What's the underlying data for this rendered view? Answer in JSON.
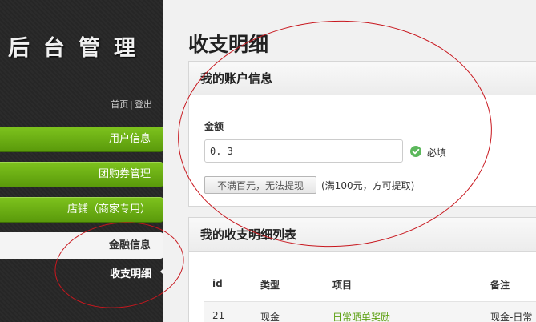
{
  "sidebar": {
    "logo": "后台管理",
    "links": {
      "home": "首页",
      "separator": "|",
      "logout": "登出"
    },
    "items": [
      {
        "label": "用户信息"
      },
      {
        "label": "团购券管理"
      },
      {
        "label": "店铺（商家专用）"
      },
      {
        "label": "金融信息"
      },
      {
        "label": "收支明细"
      }
    ]
  },
  "main": {
    "title": "收支明细",
    "account": {
      "heading": "我的账户信息",
      "amount_label": "金额",
      "amount_value": "0. 3",
      "required_label": "必填",
      "withdraw_button": "不满百元，无法提现",
      "withdraw_hint": "(满100元，方可提取)"
    },
    "list": {
      "heading": "我的收支明细列表",
      "columns": [
        "id",
        "类型",
        "项目",
        "备注"
      ],
      "rows": [
        {
          "id": "21",
          "type": "现金",
          "item": "日常晒单奖励",
          "note": "现金-日常"
        }
      ]
    }
  },
  "colors": {
    "nav_green": "#6aae15",
    "annotation_red": "#c8171e",
    "success_green": "#5cb85c"
  }
}
